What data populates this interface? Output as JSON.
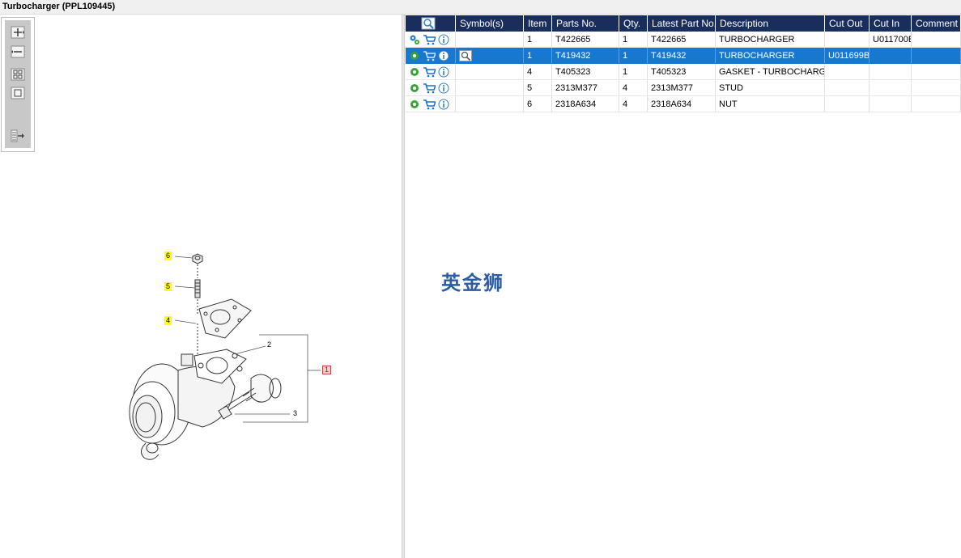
{
  "window": {
    "title": "Turbocharger (PPL109445)"
  },
  "toolbar": {
    "buttons": [
      {
        "name": "zoom-in"
      },
      {
        "name": "zoom-out"
      },
      {
        "name": "fit-page"
      },
      {
        "name": "actual-size"
      },
      {
        "name": "toggle-panel"
      }
    ]
  },
  "diagram": {
    "callouts": [
      {
        "label": "6",
        "style": "highlight-yellow"
      },
      {
        "label": "5",
        "style": "highlight-yellow"
      },
      {
        "label": "4",
        "style": "highlight-yellow"
      },
      {
        "label": "2",
        "style": "plain"
      },
      {
        "label": "1",
        "style": "highlight-red"
      },
      {
        "label": "3",
        "style": "plain"
      }
    ]
  },
  "grid": {
    "columns": [
      "",
      "Symbol(s)",
      "Item",
      "Parts No.",
      "Qty.",
      "Latest Part No.",
      "Description",
      "Cut Out",
      "Cut In",
      "Comment"
    ],
    "rows": [
      {
        "item": "1",
        "part_no": "T422665",
        "qty": "1",
        "latest": "T422665",
        "desc": "TURBOCHARGER",
        "cut_out": "",
        "cut_in": "U011700E",
        "comment": "",
        "selected": false
      },
      {
        "item": "1",
        "part_no": "T419432",
        "qty": "1",
        "latest": "T419432",
        "desc": "TURBOCHARGER",
        "cut_out": "U011699B",
        "cut_in": "",
        "comment": "",
        "selected": true
      },
      {
        "item": "4",
        "part_no": "T405323",
        "qty": "1",
        "latest": "T405323",
        "desc": "GASKET - TURBOCHARGER",
        "cut_out": "",
        "cut_in": "",
        "comment": "",
        "selected": false
      },
      {
        "item": "5",
        "part_no": "2313M377",
        "qty": "4",
        "latest": "2313M377",
        "desc": "STUD",
        "cut_out": "",
        "cut_in": "",
        "comment": "",
        "selected": false
      },
      {
        "item": "6",
        "part_no": "2318A634",
        "qty": "4",
        "latest": "2318A634",
        "desc": "NUT",
        "cut_out": "",
        "cut_in": "",
        "comment": "",
        "selected": false
      }
    ]
  },
  "watermark": "英金狮",
  "colors": {
    "header_bg": "#1a2e5e",
    "selected_row": "#1778d2",
    "cart_icon": "#1e6fc8",
    "gear_icon": "#3aa33a",
    "info_icon": "#2f7fd0",
    "callout_yellow": "#ffff00",
    "callout_red": "#d04040"
  }
}
